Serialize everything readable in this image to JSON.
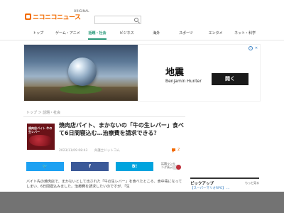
{
  "header": {
    "logo_text": "ニコニコニュース",
    "badge": "ORIGINAL",
    "search_placeholder": ""
  },
  "nav": {
    "items": [
      "トップ",
      "ゲーム・アニメ",
      "話題・社会",
      "ビジネス",
      "海外",
      "スポーツ",
      "エンタメ",
      "ネット・科学"
    ],
    "active_index": 2
  },
  "ad": {
    "title": "地震",
    "subtitle": "Benjamin Hunter",
    "button": "開く"
  },
  "breadcrumb": "トップ ＞ 話題・社会",
  "article": {
    "thumb_caption": "焼肉店バイト 牛の生レバー",
    "title": "焼肉店バイト、まかないの「牛の生レバー」食べて6日間寝込む…治療費を請求できる？",
    "date": "2023/11/09 08:43",
    "source": "弁護士ドットコム",
    "comment_count": "2"
  },
  "share": {
    "twitter": "",
    "facebook": "f",
    "hatena": "B!",
    "ranking_label": "話題ランキング表示"
  },
  "body_text": "バイト先の焼肉店で、まかないとして出された「牛の生レバー」を食べたところ、食中毒になってしまい、6日間寝込みました。治療費を請求したいのですが、「生",
  "sidebar": {
    "pickup_label": "ピックアップ",
    "more_label": "もっと見る",
    "item": "【スーパーマリオRPG】...."
  },
  "colors": {
    "brand": "#f26b00",
    "nav_active": "#2a9a7a",
    "twitter": "#1da1f2",
    "facebook": "#3b5998",
    "hatena": "#00a4de"
  }
}
